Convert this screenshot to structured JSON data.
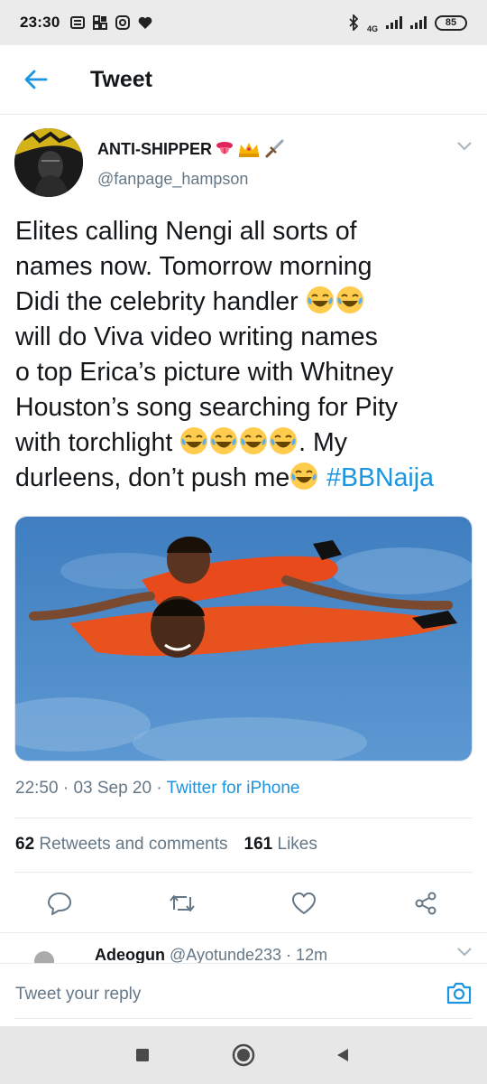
{
  "status_bar": {
    "time": "23:30",
    "network": "4G",
    "battery": "85"
  },
  "header": {
    "title": "Tweet"
  },
  "tweet": {
    "display_name": "ANTI-SHIPPER",
    "handle": "@fanpage_hampson",
    "text_lines": [
      "Elites calling Nengi all sorts of",
      "names now. Tomorrow morning",
      "Didi the celebrity handler",
      "will do Viva video writing names",
      "o top Erica’s picture with Whitney",
      "Houston’s song searching for Pity",
      "with torchlight",
      ". My",
      "durleens, don’t push me",
      "#BBNaija"
    ],
    "time": "22:50",
    "date": "03 Sep 20",
    "source": "Twitter for iPhone",
    "retweets_count": "62",
    "retweets_label": "Retweets and comments",
    "likes_count": "161",
    "likes_label": "Likes"
  },
  "reply_preview": {
    "name": "Adeogun",
    "handle": "@Ayotunde233 · 12m"
  },
  "compose": {
    "placeholder": "Tweet your reply"
  },
  "colors": {
    "accent": "#1b95e0",
    "text": "#14171a",
    "secondary": "#657786"
  },
  "icons": [
    "back-arrow-icon",
    "chevron-down-icon",
    "reply-icon",
    "retweet-icon",
    "like-icon",
    "share-icon",
    "camera-icon"
  ]
}
